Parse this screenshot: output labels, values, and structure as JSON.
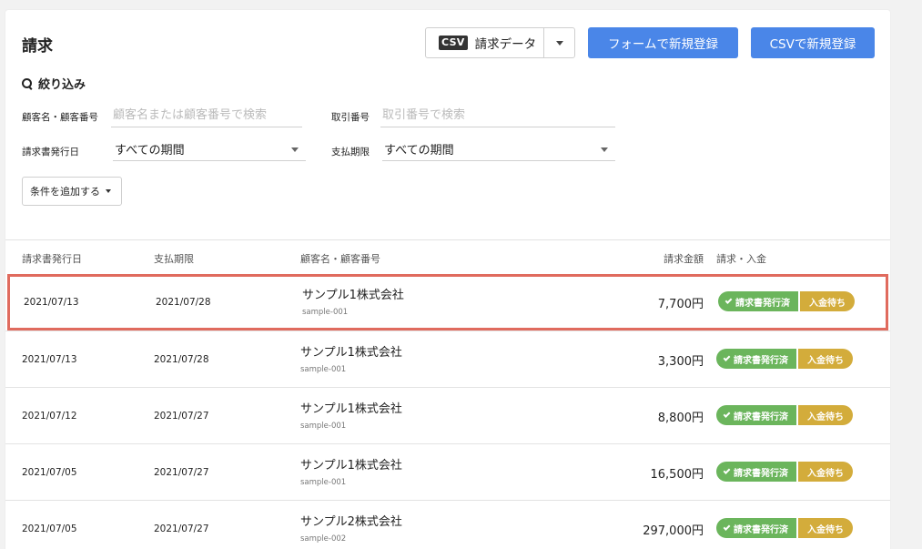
{
  "header": {
    "title": "請求",
    "csv_badge": "CSV",
    "csv_button_label": "請求データ",
    "form_register_label": "フォームで新規登録",
    "csv_register_label": "CSVで新規登録"
  },
  "filters": {
    "heading": "絞り込み",
    "customer_label": "顧客名・顧客番号",
    "customer_placeholder": "顧客名または顧客番号で検索",
    "deal_label": "取引番号",
    "deal_placeholder": "取引番号で検索",
    "issue_date_label": "請求書発行日",
    "issue_date_value": "すべての期間",
    "due_label": "支払期限",
    "due_value": "すべての期間",
    "add_condition_label": "条件を追加する"
  },
  "table": {
    "headers": {
      "issue_date": "請求書発行日",
      "due_date": "支払期限",
      "customer": "顧客名・顧客番号",
      "amount": "請求金額",
      "status": "請求・入金"
    },
    "rows": [
      {
        "issue_date": "2021/07/13",
        "due_date": "2021/07/28",
        "customer": "サンプル1株式会社",
        "customer_id": "sample-001",
        "amount": "7,700円",
        "status_issued": "請求書発行済",
        "status_payment": "入金待ち"
      },
      {
        "issue_date": "2021/07/13",
        "due_date": "2021/07/28",
        "customer": "サンプル1株式会社",
        "customer_id": "sample-001",
        "amount": "3,300円",
        "status_issued": "請求書発行済",
        "status_payment": "入金待ち"
      },
      {
        "issue_date": "2021/07/12",
        "due_date": "2021/07/27",
        "customer": "サンプル1株式会社",
        "customer_id": "sample-001",
        "amount": "8,800円",
        "status_issued": "請求書発行済",
        "status_payment": "入金待ち"
      },
      {
        "issue_date": "2021/07/05",
        "due_date": "2021/07/27",
        "customer": "サンプル1株式会社",
        "customer_id": "sample-001",
        "amount": "16,500円",
        "status_issued": "請求書発行済",
        "status_payment": "入金待ち"
      },
      {
        "issue_date": "2021/07/05",
        "due_date": "2021/07/27",
        "customer": "サンプル2株式会社",
        "customer_id": "sample-002",
        "amount": "297,000円",
        "status_issued": "請求書発行済",
        "status_payment": "入金待ち"
      }
    ]
  },
  "colors": {
    "primary": "#4a86e8",
    "issued": "#6bb55c",
    "awaiting_payment": "#d3ac3b",
    "highlight": "#e06b5e"
  }
}
